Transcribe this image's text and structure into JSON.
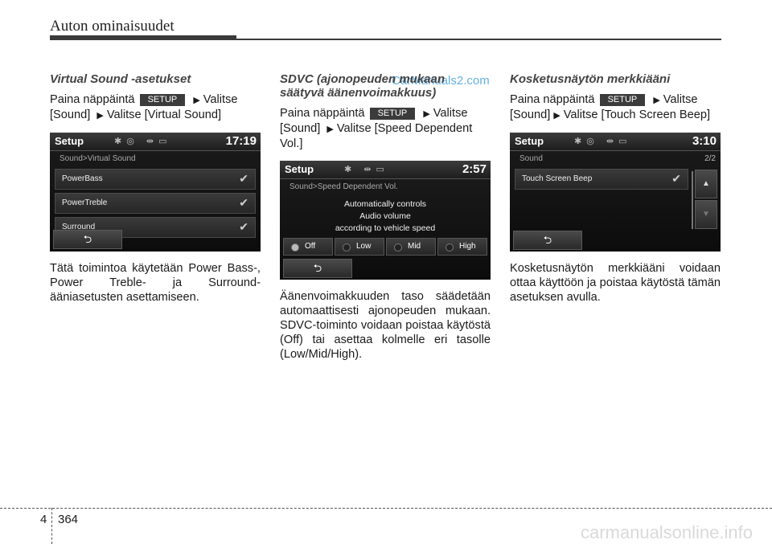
{
  "header": {
    "title": "Auton ominaisuudet"
  },
  "watermark": "CarManuals2.com",
  "sections": [
    {
      "title": "Virtual Sound -asetukset",
      "instr_a": "Paina näppäintä",
      "badge": "SETUP",
      "instr_b": "Valitse",
      "instr_c": "[Sound]",
      "instr_d": "Valitse [Virtual Sound]",
      "screen": {
        "title": "Setup",
        "time": "17:19",
        "path": "Sound>Virtual Sound",
        "rows": [
          "PowerBass",
          "PowerTreble",
          "Surround"
        ],
        "check_icon": "check-icon",
        "back_icon": "back-icon"
      },
      "body": "Tätä toimintoa käytetään Power Bass-, Power Treble- ja Surround-ääniasetusten asettamiseen."
    },
    {
      "title_line1": "SDVC (ajonopeuden mukaan",
      "title_line2": "säätyvä äänenvoimakkuus)",
      "instr_a": "Paina näppäintä",
      "badge": "SETUP",
      "instr_b": "Valitse",
      "instr_c": "[Sound]",
      "instr_d": "Valitse [Speed Dependent Vol.]",
      "screen": {
        "title": "Setup",
        "time": "2:57",
        "path": "Sound>Speed Dependent Vol.",
        "line1": "Automatically controls",
        "line2": "Audio volume",
        "line3": "according to vehicle speed",
        "modes": [
          "Off",
          "Low",
          "Mid",
          "High"
        ],
        "active_mode": "Off",
        "back_icon": "back-icon"
      },
      "body": "Äänenvoimakkuuden taso säädetään automaattisesti ajonopeuden mukaan. SDVC-toiminto voidaan poistaa käytöstä (Off) tai asettaa kolmelle eri tasolle (Low/Mid/High)."
    },
    {
      "title": "Kosketusnäytön merkkiääni",
      "instr_a": "Paina näppäintä",
      "badge": "SETUP",
      "instr_b": "Valitse",
      "instr_c": "[Sound]",
      "instr_d": "Valitse [Touch Screen Beep]",
      "screen": {
        "title": "Setup",
        "time": "3:10",
        "path": "Sound",
        "page": "2/2",
        "rows": [
          "Touch Screen Beep"
        ],
        "up_icon": "up-arrow-icon",
        "down_icon": "down-arrow-icon",
        "back_icon": "back-icon"
      },
      "body": "Kosketusnäytön merkkiääni voidaan ottaa käyttöön ja poistaa käytöstä tämän asetuksen avulla."
    }
  ],
  "footer": {
    "chapter": "4",
    "page": "364",
    "site": "carmanualsonline.info"
  }
}
